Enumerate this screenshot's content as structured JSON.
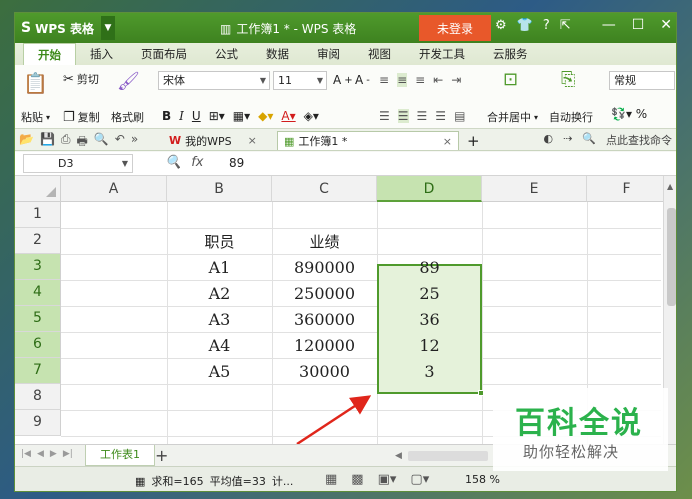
{
  "title_bar": {
    "app_name": "WPS 表格",
    "document_title": "工作簿1 * - WPS 表格",
    "login_button": "未登录",
    "colors": {
      "accent": "#4f9a2c",
      "login": "#e8582a"
    }
  },
  "menu_tabs": [
    "开始",
    "插入",
    "页面布局",
    "公式",
    "数据",
    "审阅",
    "视图",
    "开发工具",
    "云服务"
  ],
  "ribbon": {
    "paste": "粘贴",
    "cut": "剪切",
    "copy": "复制",
    "format_painter": "格式刷",
    "font_name": "宋体",
    "font_size": "11",
    "merge_center": "合并居中",
    "wrap_text": "自动换行",
    "number_format": "常规"
  },
  "doc_tabs": {
    "wps_home": "我的WPS",
    "workbook": "工作簿1 *",
    "search": "点此查找命令"
  },
  "formula_bar": {
    "cell_ref": "D3",
    "value": "89"
  },
  "columns": [
    "A",
    "B",
    "C",
    "D",
    "E",
    "F"
  ],
  "rows": [
    "1",
    "2",
    "3",
    "4",
    "5",
    "6",
    "7",
    "8",
    "9"
  ],
  "table": {
    "header_b": "职员",
    "header_c": "业绩",
    "rows": [
      {
        "b": "A1",
        "c": "890000",
        "d": "89"
      },
      {
        "b": "A2",
        "c": "250000",
        "d": "25"
      },
      {
        "b": "A3",
        "c": "360000",
        "d": "36"
      },
      {
        "b": "A4",
        "c": "120000",
        "d": "12"
      },
      {
        "b": "A5",
        "c": "30000",
        "d": "3"
      }
    ]
  },
  "sheet_tab": "工作表1",
  "status": {
    "sum": "求和=165",
    "avg": "平均值=33",
    "more": "计...",
    "zoom": "158 %"
  },
  "watermark": {
    "title": "百科全说",
    "subtitle": "助你轻松解决"
  }
}
